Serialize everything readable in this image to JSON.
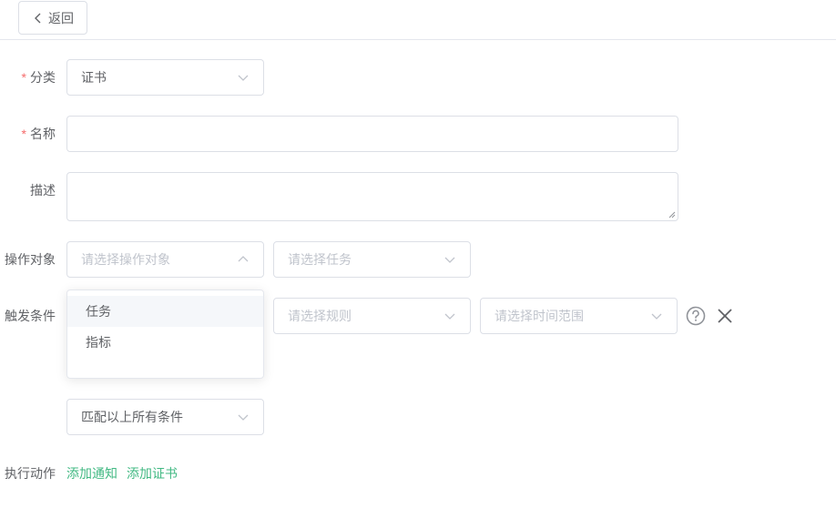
{
  "header": {
    "back_label": "返回"
  },
  "form": {
    "category": {
      "label": "分类",
      "required_mark": "*",
      "value": "证书"
    },
    "name": {
      "label": "名称",
      "required_mark": "*",
      "value": ""
    },
    "description": {
      "label": "描述",
      "value": ""
    },
    "operation_target": {
      "label": "操作对象",
      "target_placeholder": "请选择操作对象",
      "task_placeholder": "请选择任务",
      "dropdown_open": true,
      "options": [
        "任务",
        "指标"
      ],
      "hovered_option": "任务"
    },
    "trigger": {
      "label": "触发条件",
      "rule_placeholder": "请选择规则",
      "time_range_placeholder": "请选择时间范围",
      "help_icon": "question-circle-icon",
      "remove_icon": "close-icon"
    },
    "match": {
      "value": "匹配以上所有条件"
    },
    "actions": {
      "label": "执行动作",
      "add_notice": "添加通知",
      "add_cert": "添加证书"
    }
  },
  "colors": {
    "required": "#f56c6c",
    "link": "#42b983",
    "border": "#dcdfe6",
    "placeholder": "#c0c4cc",
    "text": "#606266"
  }
}
